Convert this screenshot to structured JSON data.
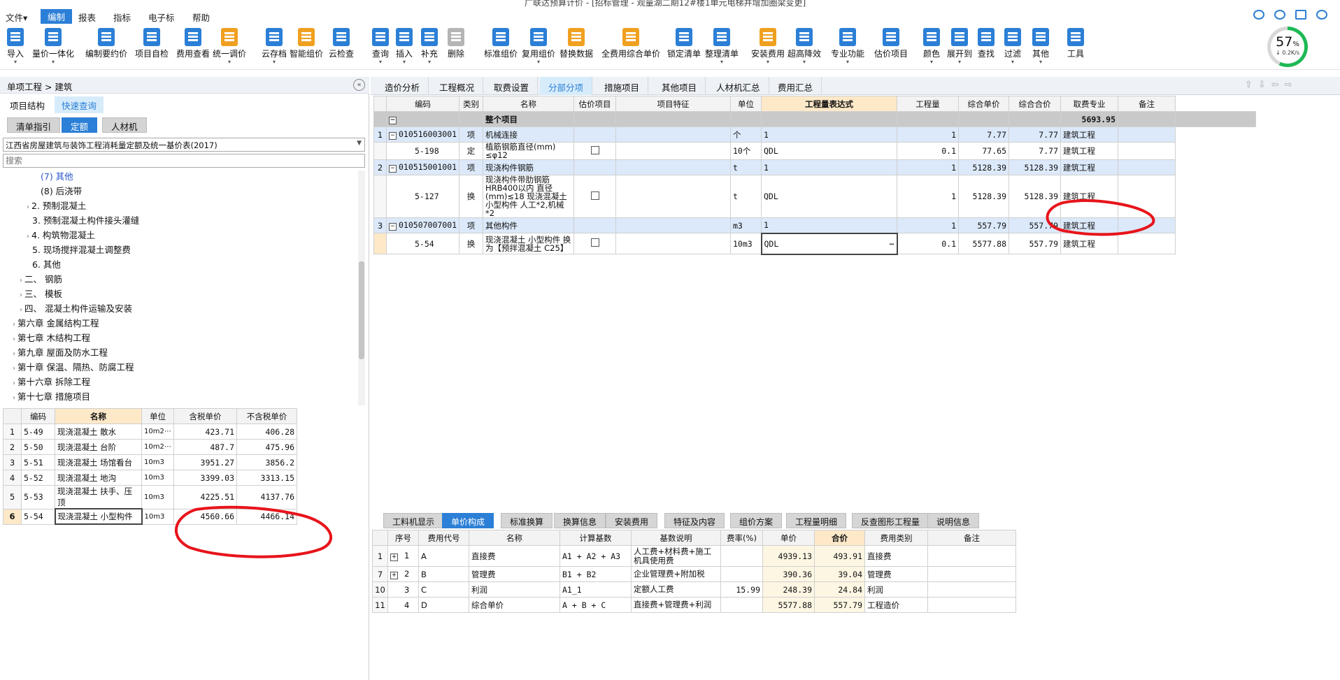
{
  "window": {
    "title": "广联达预算计价 - [招标管理 - 观量湖二期12#楼1单元电梯井增加圈梁变更]"
  },
  "menu": [
    "文件▾",
    "编制",
    "报表",
    "指标",
    "电子标",
    "帮助"
  ],
  "toolbar": [
    {
      "label": "导入",
      "icon": "import-icon",
      "color": "#2b7fd6",
      "caret": true
    },
    {
      "label": "量价一体化",
      "icon": "integration-icon",
      "color": "#2b7fd6",
      "caret": true
    },
    {
      "label": "编制要约价",
      "icon": "edit-price-icon",
      "color": "#2b7fd6",
      "caret": false
    },
    {
      "label": "项目自检",
      "icon": "check-icon",
      "color": "#2b7fd6",
      "caret": false
    },
    {
      "label": "费用查看",
      "icon": "cost-view-icon",
      "color": "#2b7fd6",
      "caret": false
    },
    {
      "label": "统一调价",
      "icon": "adjust-price-icon",
      "color": "#f0a020",
      "caret": true
    },
    {
      "label": "云存档",
      "icon": "cloud-save-icon",
      "color": "#2b7fd6",
      "caret": true
    },
    {
      "label": "智能组价",
      "icon": "smart-price-icon",
      "color": "#f0a020",
      "caret": false
    },
    {
      "label": "云检查",
      "icon": "cloud-check-icon",
      "color": "#2b7fd6",
      "caret": false
    },
    {
      "label": "查询",
      "icon": "query-icon",
      "color": "#2b7fd6",
      "caret": true
    },
    {
      "label": "插入",
      "icon": "insert-icon",
      "color": "#2b7fd6",
      "caret": true
    },
    {
      "label": "补充",
      "icon": "supplement-icon",
      "color": "#2b7fd6",
      "caret": true
    },
    {
      "label": "删除",
      "icon": "delete-icon",
      "color": "#b5b5b5",
      "caret": false
    },
    {
      "label": "标准组价",
      "icon": "standard-price-icon",
      "color": "#2b7fd6",
      "caret": false
    },
    {
      "label": "复用组价",
      "icon": "reuse-price-icon",
      "color": "#2b7fd6",
      "caret": true
    },
    {
      "label": "替换数据",
      "icon": "replace-data-icon",
      "color": "#f0a020",
      "caret": false
    },
    {
      "label": "全费用综合单价",
      "icon": "full-cost-icon",
      "color": "#f0a020",
      "caret": false
    },
    {
      "label": "锁定清单",
      "icon": "lock-icon",
      "color": "#2b7fd6",
      "caret": false
    },
    {
      "label": "整理清单",
      "icon": "organize-icon",
      "color": "#2b7fd6",
      "caret": true
    },
    {
      "label": "安装费用",
      "icon": "install-cost-icon",
      "color": "#f0a020",
      "caret": true
    },
    {
      "label": "超高降效",
      "icon": "height-icon",
      "color": "#2b7fd6",
      "caret": true
    },
    {
      "label": "专业功能",
      "icon": "pro-function-icon",
      "color": "#2b7fd6",
      "caret": true
    },
    {
      "label": "估价项目",
      "icon": "estimate-icon",
      "color": "#2b7fd6",
      "caret": false
    },
    {
      "label": "颜色",
      "icon": "color-icon",
      "color": "#2b7fd6",
      "caret": true
    },
    {
      "label": "展开到",
      "icon": "expand-icon",
      "color": "#2b7fd6",
      "caret": true
    },
    {
      "label": "查找",
      "icon": "find-icon",
      "color": "#2b7fd6",
      "caret": false
    },
    {
      "label": "过滤",
      "icon": "filter-icon",
      "color": "#2b7fd6",
      "caret": true
    },
    {
      "label": "其他",
      "icon": "other-icon",
      "color": "#2b7fd6",
      "caret": true
    },
    {
      "label": "工具",
      "icon": "tools-icon",
      "color": "#2b7fd6",
      "caret": false
    }
  ],
  "gauge": {
    "percent_value": 57,
    "percent": "57",
    "percent_unit": "%",
    "speed": "↓ 0.2K/s"
  },
  "left": {
    "breadcrumb": "单项工程 > 建筑",
    "tabs": [
      "项目结构",
      "快速查询"
    ],
    "subtabs": [
      "清单指引",
      "定额",
      "人材机"
    ],
    "library": "江西省房屋建筑与装饰工程消耗量定额及统一基价表(2017)",
    "search_placeholder": "搜索",
    "tree": [
      {
        "label": "(7) 其他",
        "toggle": "",
        "color": "#2b55c8"
      },
      {
        "label": "(8) 后浇带",
        "toggle": "",
        "color": "#111"
      },
      {
        "label": "2. 预制混凝土",
        "toggle": "›",
        "color": "#111"
      },
      {
        "label": "3. 预制混凝土构件接头灌缝",
        "toggle": "",
        "color": "#111"
      },
      {
        "label": "4. 构筑物混凝土",
        "toggle": "›",
        "color": "#111"
      },
      {
        "label": "5. 现场搅拌混凝土调整费",
        "toggle": "",
        "color": "#111"
      },
      {
        "label": "6. 其他",
        "toggle": "",
        "color": "#111"
      },
      {
        "label": "二、 钢筋",
        "toggle": "›",
        "color": "#111"
      },
      {
        "label": "三、 模板",
        "toggle": "›",
        "color": "#111"
      },
      {
        "label": "四、 混凝土构件运输及安装",
        "toggle": "›",
        "color": "#111"
      },
      {
        "label": "第六章 金属结构工程",
        "toggle": "›",
        "color": "#111"
      },
      {
        "label": "第七章 木结构工程",
        "toggle": "›",
        "color": "#111"
      },
      {
        "label": "第九章 屋面及防水工程",
        "toggle": "›",
        "color": "#111"
      },
      {
        "label": "第十章 保温、隔热、防腐工程",
        "toggle": "›",
        "color": "#111"
      },
      {
        "label": "第十六章 拆除工程",
        "toggle": "›",
        "color": "#111"
      },
      {
        "label": "第十七章 措施项目",
        "toggle": "›",
        "color": "#111"
      }
    ],
    "quota_headers": [
      "编码",
      "名称",
      "单位",
      "含税单价",
      "不含税单价"
    ],
    "quota_rows": [
      {
        "no": "1",
        "code": "5-49",
        "name": "现浇混凝土 散水",
        "unit": "10m2⋯",
        "tax_price": "423.71",
        "notax_price": "406.28"
      },
      {
        "no": "2",
        "code": "5-50",
        "name": "现浇混凝土 台阶",
        "unit": "10m2⋯",
        "tax_price": "487.7",
        "notax_price": "475.96"
      },
      {
        "no": "3",
        "code": "5-51",
        "name": "现浇混凝土 场馆看台",
        "unit": "10m3",
        "tax_price": "3951.27",
        "notax_price": "3856.2"
      },
      {
        "no": "4",
        "code": "5-52",
        "name": "现浇混凝土 地沟",
        "unit": "10m3",
        "tax_price": "3399.03",
        "notax_price": "3313.15"
      },
      {
        "no": "5",
        "code": "5-53",
        "name": "现浇混凝土 扶手、压顶",
        "unit": "10m3",
        "tax_price": "4225.51",
        "notax_price": "4137.76"
      },
      {
        "no": "6",
        "code": "5-54",
        "name": "现浇混凝土 小型构件",
        "unit": "10m3",
        "tax_price": "4560.66",
        "notax_price": "4466.14"
      }
    ]
  },
  "right": {
    "tabs": [
      "造价分析",
      "工程概况",
      "取费设置",
      "分部分项",
      "措施项目",
      "其他项目",
      "人材机汇总",
      "费用汇总"
    ],
    "active_tab": 3,
    "headers": [
      "编码",
      "类别",
      "名称",
      "估价项目",
      "项目特征",
      "单位",
      "工程量表达式",
      "工程量",
      "综合单价",
      "综合合价",
      "取费专业",
      "备注"
    ],
    "total_row": {
      "name": "整个项目",
      "total": "5693.95"
    },
    "rows": [
      {
        "no": "1",
        "code": "010516003001",
        "type": "项",
        "name": "机械连接",
        "unit": "个",
        "expr": "1",
        "qty": "1",
        "price": "7.77",
        "total": "7.77",
        "major": "建筑工程",
        "level": "item"
      },
      {
        "no": "",
        "code": "5-198",
        "type": "定",
        "name": "植筋钢筋直径(mm) ≤φ12",
        "unit": "10个",
        "expr": "QDL",
        "qty": "0.1",
        "price": "77.65",
        "total": "7.77",
        "major": "建筑工程",
        "level": "sub"
      },
      {
        "no": "2",
        "code": "010515001001",
        "type": "项",
        "name": "现浇构件钢筋",
        "unit": "t",
        "expr": "1",
        "qty": "1",
        "price": "5128.39",
        "total": "5128.39",
        "major": "建筑工程",
        "level": "item"
      },
      {
        "no": "",
        "code": "5-127",
        "type": "换",
        "name": "现浇构件带肋钢筋HRB400以内 直径(mm)≤18  现浇混凝土小型构件 人工*2,机械*2",
        "unit": "t",
        "expr": "QDL",
        "qty": "1",
        "price": "5128.39",
        "total": "5128.39",
        "major": "建筑工程",
        "level": "sub"
      },
      {
        "no": "3",
        "code": "010507007001",
        "type": "项",
        "name": "其他构件",
        "unit": "m3",
        "expr": "1",
        "qty": "1",
        "price": "557.79",
        "total": "557.79",
        "major": "建筑工程",
        "level": "item"
      },
      {
        "no": "",
        "code": "5-54",
        "type": "换",
        "name": "现浇混凝土 小型构件  换为【预拌混凝土 C25】",
        "unit": "10m3",
        "expr": "QDL",
        "qty": "0.1",
        "price": "5577.88",
        "total": "557.79",
        "major": "建筑工程",
        "level": "sub"
      }
    ],
    "bottom_tabs": [
      "工料机显示",
      "单价构成",
      "标准换算",
      "换算信息",
      "安装费用",
      "特征及内容",
      "组价方案",
      "工程量明细",
      "反查图形工程量",
      "说明信息"
    ],
    "bottom_active": 1,
    "cost_headers": [
      "序号",
      "费用代号",
      "名称",
      "计算基数",
      "基数说明",
      "费率(%)",
      "单价",
      "合价",
      "费用类别",
      "备注"
    ],
    "cost_rows": [
      {
        "row": "1",
        "exp": "+",
        "seq": "1",
        "code": "A",
        "name": "直接费",
        "base": "A1 + A2 + A3",
        "desc": "人工费+材料费+施工机具使用费",
        "rate": "",
        "price": "4939.13",
        "total": "493.91",
        "cat": "直接费"
      },
      {
        "row": "7",
        "exp": "+",
        "seq": "2",
        "code": "B",
        "name": "管理费",
        "base": "B1 + B2",
        "desc": "企业管理费+附加税",
        "rate": "",
        "price": "390.36",
        "total": "39.04",
        "cat": "管理费"
      },
      {
        "row": "10",
        "exp": "",
        "seq": "3",
        "code": "C",
        "name": "利润",
        "base": "A1_1",
        "desc": "定额人工费",
        "rate": "15.99",
        "price": "248.39",
        "total": "24.84",
        "cat": "利润"
      },
      {
        "row": "11",
        "exp": "",
        "seq": "4",
        "code": "D",
        "name": "综合单价",
        "base": "A + B + C",
        "desc": "直接费+管理费+利润",
        "rate": "",
        "price": "5577.88",
        "total": "557.79",
        "cat": "工程造价"
      }
    ]
  },
  "colors": {
    "accent": "#2b7fd6",
    "selected_row": "#dce9fa",
    "annotation": "#e8141b"
  }
}
